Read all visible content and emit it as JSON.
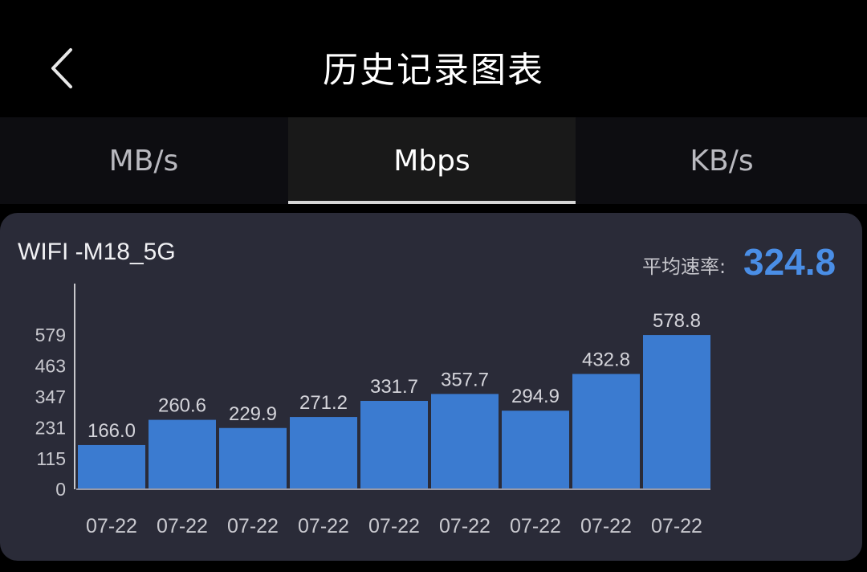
{
  "header": {
    "title": "历史记录图表",
    "back_icon": "chevron-left-icon"
  },
  "tabs": [
    {
      "label": "MB/s",
      "active": false
    },
    {
      "label": "Mbps",
      "active": true
    },
    {
      "label": "KB/s",
      "active": false
    }
  ],
  "card": {
    "network_name": "WIFI -M18_5G",
    "avg_label": "平均速率:",
    "avg_value": "324.8"
  },
  "colors": {
    "accent": "#4a8ee6",
    "bar": "#3b7bd0",
    "card_bg": "#2a2b38",
    "background": "#000000"
  },
  "chart_data": {
    "type": "bar",
    "categories": [
      "07-22",
      "07-22",
      "07-22",
      "07-22",
      "07-22",
      "07-22",
      "07-22",
      "07-22",
      "07-22"
    ],
    "values": [
      166.0,
      260.6,
      229.9,
      271.2,
      331.7,
      357.7,
      294.9,
      432.8,
      578.8
    ],
    "value_labels": [
      "166.0",
      "260.6",
      "229.9",
      "271.2",
      "331.7",
      "357.7",
      "294.9",
      "432.8",
      "578.8"
    ],
    "y_ticks": [
      0,
      115,
      231,
      347,
      463,
      579
    ],
    "ylim": [
      0,
      579
    ],
    "grid": false,
    "legend": "none"
  }
}
